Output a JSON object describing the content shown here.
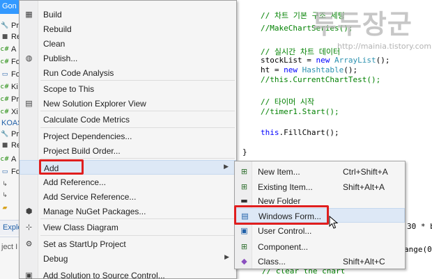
{
  "solution_explorer": {
    "header": "Gon",
    "rows": [
      {
        "icon": "wrench-icon",
        "text": "Pr"
      },
      {
        "icon": "references-icon",
        "text": "Re"
      },
      {
        "icon": "cs-file-icon",
        "text": "A"
      },
      {
        "icon": "cs-file-icon",
        "text": "Fo"
      },
      {
        "icon": "form-icon",
        "text": "Fo"
      },
      {
        "icon": "cs-file-icon",
        "text": "Ki"
      },
      {
        "icon": "cs-file-icon",
        "text": "Pr"
      },
      {
        "icon": "cs-file-icon",
        "text": "Xi"
      },
      {
        "icon": "none",
        "text": "KOAS"
      },
      {
        "icon": "wrench-icon",
        "text": "Pr"
      },
      {
        "icon": "references-icon",
        "text": "Re"
      },
      {
        "icon": "cs-file-icon",
        "text": "A"
      },
      {
        "icon": "form-icon",
        "text": "Fo"
      },
      {
        "icon": "arrow-icon",
        "text": ""
      },
      {
        "icon": "arrow-icon",
        "text": ""
      },
      {
        "icon": "folder-icon",
        "text": ""
      }
    ],
    "tab_label": "Explo",
    "properties_label": "ject I"
  },
  "code": {
    "lines": [
      {
        "parts": [
          {
            "t": "// 차트 기본 구조 세팅",
            "c": "c-cmt"
          }
        ]
      },
      {
        "parts": [
          {
            "t": "//MakeChartSeries();",
            "c": "c-cmt"
          }
        ]
      },
      {
        "parts": [
          {
            "t": "",
            "c": "c-txt"
          }
        ]
      },
      {
        "parts": [
          {
            "t": "// 실시간 차트 데이터",
            "c": "c-cmt"
          }
        ]
      },
      {
        "parts": [
          {
            "t": "stockList = ",
            "c": "c-txt"
          },
          {
            "t": "new ",
            "c": "c-kw"
          },
          {
            "t": "ArrayList",
            "c": "c-type"
          },
          {
            "t": "();",
            "c": "c-txt"
          }
        ]
      },
      {
        "parts": [
          {
            "t": "ht = ",
            "c": "c-txt"
          },
          {
            "t": "new ",
            "c": "c-kw"
          },
          {
            "t": "Hashtable",
            "c": "c-type"
          },
          {
            "t": "();",
            "c": "c-txt"
          }
        ]
      },
      {
        "parts": [
          {
            "t": "//this.CurrentChartTest();",
            "c": "c-cmt"
          }
        ]
      },
      {
        "parts": [
          {
            "t": "",
            "c": "c-txt"
          }
        ]
      },
      {
        "parts": [
          {
            "t": "// 타이머 시작",
            "c": "c-cmt"
          }
        ]
      },
      {
        "parts": [
          {
            "t": "//timer1.Start();",
            "c": "c-cmt"
          }
        ]
      },
      {
        "parts": [
          {
            "t": "",
            "c": "c-txt"
          }
        ]
      },
      {
        "parts": [
          {
            "t": "this",
            "c": "c-kw"
          },
          {
            "t": ".FillChart();",
            "c": "c-txt"
          }
        ]
      }
    ],
    "brace": "}",
    "tail1": "30 * b",
    "tail2": "ange(0,",
    "tail3": "// clear the chart"
  },
  "watermark": {
    "text": "투두장군",
    "url": "http://mainia.tistory.com"
  },
  "context_menu": {
    "items": [
      {
        "label": "Build",
        "icon": "build-icon",
        "glyph": "▦"
      },
      {
        "label": "Rebuild",
        "icon": "",
        "glyph": ""
      },
      {
        "label": "Clean",
        "icon": "",
        "glyph": ""
      },
      {
        "label": "Publish...",
        "icon": "globe-icon",
        "glyph": "◍"
      },
      {
        "label": "Run Code Analysis",
        "icon": "",
        "glyph": ""
      },
      {
        "label": "Scope to This",
        "icon": "",
        "glyph": ""
      },
      {
        "label": "New Solution Explorer View",
        "icon": "new-view-icon",
        "glyph": "▤"
      },
      {
        "label": "Calculate Code Metrics",
        "icon": "",
        "glyph": ""
      },
      {
        "label": "Project Dependencies...",
        "icon": "",
        "glyph": ""
      },
      {
        "label": "Project Build Order...",
        "icon": "",
        "glyph": ""
      },
      {
        "label": "Add",
        "icon": "",
        "glyph": "",
        "submenu": true
      },
      {
        "label": "Add Reference...",
        "icon": "",
        "glyph": ""
      },
      {
        "label": "Add Service Reference...",
        "icon": "",
        "glyph": ""
      },
      {
        "label": "Manage NuGet Packages...",
        "icon": "nuget-icon",
        "glyph": "⬢"
      },
      {
        "label": "View Class Diagram",
        "icon": "class-diagram-icon",
        "glyph": "⊹"
      },
      {
        "label": "Set as StartUp Project",
        "icon": "gear-icon",
        "glyph": "⚙"
      },
      {
        "label": "Debug",
        "icon": "",
        "glyph": "",
        "submenu": true
      },
      {
        "label": "Add Solution to Source Control...",
        "icon": "source-control-icon",
        "glyph": "▣"
      }
    ]
  },
  "add_submenu": {
    "items": [
      {
        "label": "New Item...",
        "shortcut": "Ctrl+Shift+A",
        "icon": "new-item-icon",
        "glyph": "⊞"
      },
      {
        "label": "Existing Item...",
        "shortcut": "Shift+Alt+A",
        "icon": "existing-item-icon",
        "glyph": "⊞"
      },
      {
        "label": "New Folder",
        "shortcut": "",
        "icon": "folder-icon",
        "glyph": "▬"
      },
      {
        "label": "Windows Form...",
        "shortcut": "",
        "icon": "windows-form-icon",
        "glyph": "▤"
      },
      {
        "label": "User Control...",
        "shortcut": "",
        "icon": "user-control-icon",
        "glyph": "▣"
      },
      {
        "label": "Component...",
        "shortcut": "",
        "icon": "component-icon",
        "glyph": "⊞"
      },
      {
        "label": "Class...",
        "shortcut": "Shift+Alt+C",
        "icon": "class-icon",
        "glyph": "◆"
      }
    ]
  },
  "colors": {
    "highlight_box": "#e01e1e",
    "menu_bg": "#f5f5f5",
    "selection": "#3399ff"
  }
}
